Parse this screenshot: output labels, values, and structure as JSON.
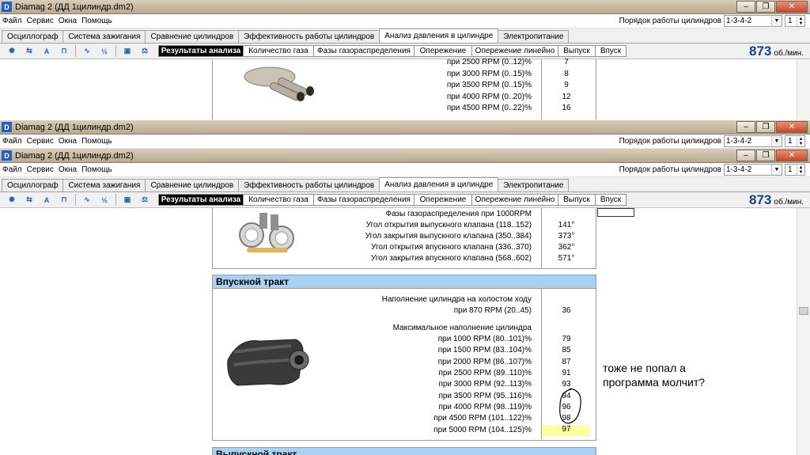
{
  "app": {
    "title_front": "Diamag 2 (ДД 1цилиндр.dm2)",
    "title_back": "Diamag 2 (ДД 1цилиндр.dm2)",
    "title_mid": "Diamag 2 (ДД 1цилиндр.dm2)"
  },
  "menu": [
    "Файл",
    "Сервис",
    "Окна",
    "Помощь"
  ],
  "cylinders": {
    "label": "Порядок работы цилиндров",
    "order": "1-3-4-2",
    "count": "1"
  },
  "tabs": [
    "Осциллограф",
    "Система зажигания",
    "Сравнение цилиндров",
    "Эффективность работы цилиндров",
    "Анализ давления в цилиндре",
    "Электропитание"
  ],
  "active_tab": "Анализ давления в цилиндре",
  "toolbar_icons": [
    "scope-icon",
    "sync-icon",
    "auto-icon",
    "measure-icon",
    "wave-icon",
    "algorithm-icon",
    "save-icon",
    "compare-icon"
  ],
  "subtabs": [
    "Результаты анализа",
    "Количество газа",
    "Фазы газораспределения",
    "Опережение",
    "Опережение линейно",
    "Выпуск",
    "Впуск"
  ],
  "rpm": {
    "value": "873",
    "unit": "об./мин."
  },
  "top_window": {
    "rows": [
      {
        "label": "при  2500 RPM (0..12)%",
        "value": "7"
      },
      {
        "label": "при  3000 RPM (0..15)%",
        "value": "8"
      },
      {
        "label": "при  3500 RPM (0..15)%",
        "value": "9"
      },
      {
        "label": "при  4000 RPM (0..20)%",
        "value": "12"
      },
      {
        "label": "при  4500 RPM (0..22)%",
        "value": "16"
      }
    ]
  },
  "timing": {
    "header": "Фазы газораспределения при 1000RPM",
    "rows": [
      {
        "label": "Угол открытия выпускного клапана (118..152)",
        "value": "141°"
      },
      {
        "label": "Угол закрытия выпускного клапана (350..384)",
        "value": "373°"
      },
      {
        "label": "Угол открытия впускного клапана (336..370)",
        "value": "362°"
      },
      {
        "label": "Угол закрытия впускного клапана (568..602)",
        "value": "571°"
      }
    ]
  },
  "intake": {
    "title": "Впускной тракт",
    "idle_label": "Наполнение цилиндра на холостом ходу",
    "idle_row": {
      "label": "при 870 RPM (20..45)",
      "value": "36"
    },
    "max_label": "Максимальное наполнение цилиндра",
    "rows": [
      {
        "label": "при  1000 RPM (80..101)%",
        "value": "79"
      },
      {
        "label": "при  1500 RPM (83..104)%",
        "value": "85"
      },
      {
        "label": "при  2000 RPM (86..107)%",
        "value": "87"
      },
      {
        "label": "при  2500 RPM (89..110)%",
        "value": "91"
      },
      {
        "label": "при  3000 RPM (92..113)%",
        "value": "93"
      },
      {
        "label": "при  3500 RPM (95..116)%",
        "value": "94"
      },
      {
        "label": "при  4000 RPM (98..119)%",
        "value": "96"
      },
      {
        "label": "при  4500 RPM (101..122)%",
        "value": "98"
      },
      {
        "label": "при  5000 RPM (104..125)%",
        "value": "97"
      }
    ],
    "highlight_color": "#ffffa0"
  },
  "exhaust_title": "Выпускной тракт",
  "note": "тоже не попал а программа молчит?"
}
